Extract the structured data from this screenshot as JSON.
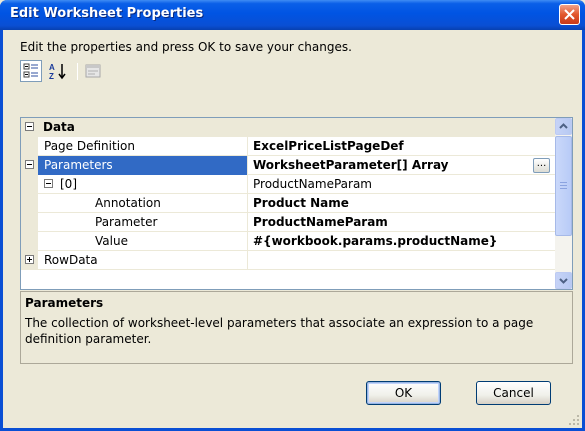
{
  "window": {
    "title": "Edit Worksheet Properties"
  },
  "instructions": "Edit the properties and press OK to save your changes.",
  "toolbar": {
    "icons": [
      "categorized-icon",
      "alphabetical-icon",
      "property-pages-icon"
    ]
  },
  "grid": {
    "category": "Data",
    "rows": [
      {
        "name": "Page Definition",
        "value": "ExcelPriceListPageDef",
        "value_bold": true
      },
      {
        "name": "Parameters",
        "value": "WorksheetParameter[] Array",
        "value_bold": true,
        "selected": true,
        "expanded": true
      },
      {
        "name": "[0]",
        "value": "ProductNameParam",
        "value_bold": false,
        "expanded": true
      },
      {
        "name": "Annotation",
        "value": "Product Name",
        "value_bold": true
      },
      {
        "name": "Parameter",
        "value": "ProductNameParam",
        "value_bold": true
      },
      {
        "name": "Value",
        "value": "#{workbook.params.productName}",
        "value_bold": true
      },
      {
        "name": "RowData",
        "value": "",
        "value_bold": false,
        "expanded": false
      }
    ],
    "ellipsis_label": "..."
  },
  "description": {
    "title": "Parameters",
    "text": "The collection of worksheet-level parameters that associate an expression to a page definition parameter."
  },
  "buttons": {
    "ok": "OK",
    "cancel": "Cancel"
  },
  "colors": {
    "titlebar": "#0054e3",
    "selection": "#316ac5",
    "close": "#e2572c"
  }
}
